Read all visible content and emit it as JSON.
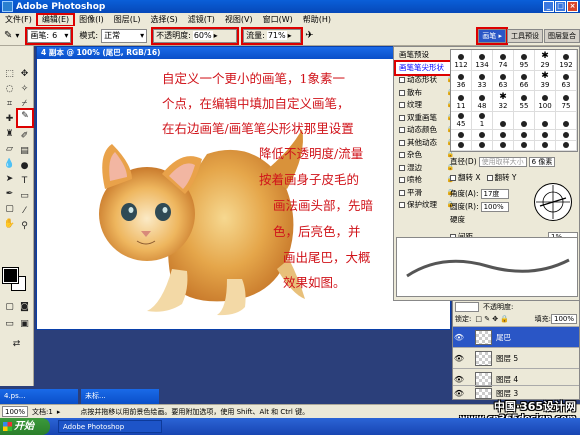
{
  "app": {
    "title": "Adobe Photoshop"
  },
  "menus": [
    "文件(F)",
    "编辑(E)",
    "图像(I)",
    "图层(L)",
    "选择(S)",
    "滤镜(T)",
    "视图(V)",
    "窗口(W)",
    "帮助(H)"
  ],
  "options": {
    "brush_label": "画笔:",
    "brush_size": "6",
    "mode_label": "模式:",
    "mode_value": "正常",
    "opacity_label": "不透明度:",
    "opacity_value": "60%",
    "flow_label": "流量:",
    "flow_value": "71%",
    "palette_tabs": [
      "画笔",
      "工具预设",
      "图层复合"
    ]
  },
  "document": {
    "title": "4 副本 @ 100% (尾巴, RGB/16)",
    "instructions": [
      "自定义一个更小的画笔，1象素一",
      "个点，在编辑中填加自定义画笔，",
      "在右边画笔/画笔笔尖形状那里设置",
      "降低不透明度/流量",
      "按着画身子皮毛的",
      "画法画头部，先暗",
      "色，后亮色，并",
      "画出尾巴，大概",
      "效果如图。"
    ]
  },
  "brush_panel": {
    "items": [
      {
        "label": "画笔预设",
        "check": false,
        "lock": false
      },
      {
        "label": "画笔笔尖形状",
        "check": false,
        "lock": false,
        "selected": true
      },
      {
        "label": "动态形状",
        "check": true,
        "lock": true
      },
      {
        "label": "散布",
        "check": true,
        "lock": true
      },
      {
        "label": "纹理",
        "check": true,
        "lock": true
      },
      {
        "label": "双重画笔",
        "check": true,
        "lock": true
      },
      {
        "label": "动态颜色",
        "check": true,
        "lock": true
      },
      {
        "label": "其他动态",
        "check": true,
        "lock": true
      },
      {
        "label": "杂色",
        "check": true,
        "lock": true
      },
      {
        "label": "湿边",
        "check": true,
        "lock": true
      },
      {
        "label": "喷枪",
        "check": true,
        "lock": true
      },
      {
        "label": "平滑",
        "check": true,
        "lock": true
      },
      {
        "label": "保护纹理",
        "check": true,
        "lock": true
      }
    ],
    "grid_numbers": [
      "112",
      "134",
      "74",
      "95",
      "29",
      "192",
      "36",
      "33",
      "63",
      "66",
      "39",
      "63",
      "11",
      "48",
      "32",
      "55",
      "100",
      "75",
      "45",
      "1",
      "",
      "",
      "",
      "",
      "",
      "",
      "",
      "",
      "",
      "",
      "",
      "",
      "",
      "",
      "",
      ""
    ],
    "diameter_label": "直径(D)",
    "use_sample": "使用取样大小",
    "diameter_value": "6 像素",
    "flip_x": "翻转 X",
    "flip_y": "翻转 Y",
    "angle_label": "角度(A):",
    "angle_value": "17度",
    "roundness_label": "圆度(R):",
    "roundness_value": "100%",
    "hardness_label": "硬度",
    "spacing_label": "间距",
    "spacing_value": "1%"
  },
  "layers": {
    "lock_label": "锁定:",
    "fill_label": "填充:",
    "fill_value": "100%",
    "opacity_label": "不透明度:",
    "items": [
      "尾巴",
      "图层 5",
      "图层 4",
      "图层 3"
    ]
  },
  "mini_docs": [
    "4.ps...",
    "未标..."
  ],
  "status": {
    "zoom": "100%",
    "doc_label": "文档:1",
    "hint": "点按并拖移以用前景色绘画。要用附加选项，使用 Shift、Alt 和 Ctrl 键。"
  },
  "taskbar": {
    "start": "开始",
    "task": "Adobe Photoshop"
  },
  "watermark": {
    "line1": "中国·365设计网",
    "line2": "www.cn365design.com"
  }
}
